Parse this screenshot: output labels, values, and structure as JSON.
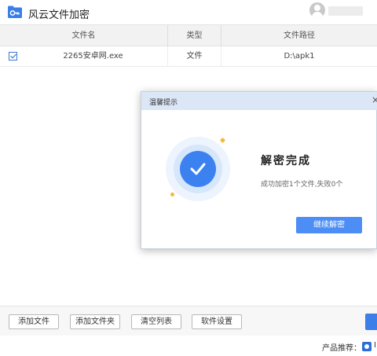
{
  "app": {
    "title": "风云文件加密"
  },
  "table": {
    "columns": [
      "文件名",
      "类型",
      "文件路径"
    ],
    "rows": [
      {
        "checked": true,
        "name": "2265安卓网.exe",
        "type": "文件",
        "path": "D:\\apk1"
      }
    ]
  },
  "toolbar": {
    "add_file": "添加文件",
    "add_folder": "添加文件夹",
    "clear_list": "清空列表",
    "settings": "软件设置"
  },
  "footer": {
    "label": "产品推荐：",
    "truncated": "I"
  },
  "dialog": {
    "title": "温馨提示",
    "close": "×",
    "heading": "解密完成",
    "message": "成功加密1个文件,失败0个",
    "continue_button": "继续解密"
  },
  "colors": {
    "accent": "#3b82f0",
    "dialog_header": "#dbe6f6",
    "sparkle": "#f6b73c"
  }
}
